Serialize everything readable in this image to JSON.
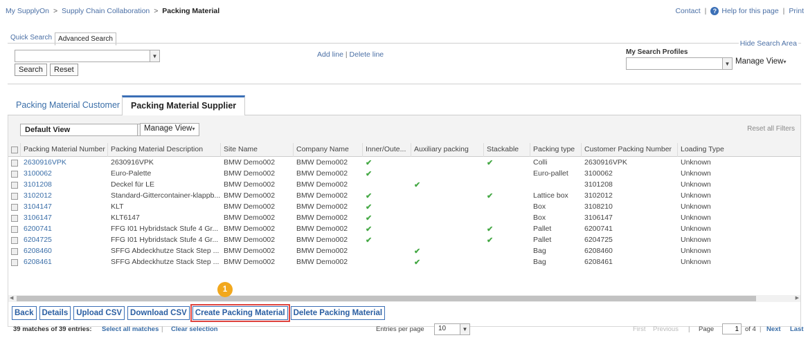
{
  "breadcrumb": {
    "home": "My SupplyOn",
    "parent": "Supply Chain Collaboration",
    "current": "Packing Material",
    "sep": ">"
  },
  "toplinks": {
    "contact": "Contact",
    "help": "Help for this page",
    "print": "Print",
    "sep": "|"
  },
  "search": {
    "tabs": [
      "Quick Search",
      "Advanced Search"
    ],
    "hide_label": "Hide Search Area",
    "search_button": "Search",
    "reset_button": "Reset",
    "add_line": "Add line",
    "delete_line": "Delete line",
    "sep": "|",
    "profiles_label": "My Search Profiles",
    "manage_view": "Manage View"
  },
  "tabs": [
    "Packing Material Customer",
    "Packing Material Supplier"
  ],
  "view": {
    "selected": "Default View",
    "manage_view": "Manage View",
    "reset_filters": "Reset all Filters"
  },
  "columns": [
    "Packing Material Number",
    "Packing Material Description",
    "Site Name",
    "Company Name",
    "Inner/Oute...",
    "Auxiliary packing",
    "Stackable",
    "Packing type",
    "Customer Packing Number",
    "Loading Type"
  ],
  "rows": [
    [
      "2630916VPK",
      "2630916VPK",
      "BMW Demo002",
      "BMW Demo002",
      "✔",
      "",
      "✔",
      "Colli",
      "2630916VPK",
      "Unknown"
    ],
    [
      "3100062",
      "Euro-Palette",
      "BMW Demo002",
      "BMW Demo002",
      "✔",
      "",
      "",
      "Euro-pallet",
      "3100062",
      "Unknown"
    ],
    [
      "3101208",
      "Deckel für LE",
      "BMW Demo002",
      "BMW Demo002",
      "",
      "✔",
      "",
      "",
      "3101208",
      "Unknown"
    ],
    [
      "3102012",
      "Standard-Gittercontainer-klappb...",
      "BMW Demo002",
      "BMW Demo002",
      "✔",
      "",
      "✔",
      "Lattice box",
      "3102012",
      "Unknown"
    ],
    [
      "3104147",
      "KLT",
      "BMW Demo002",
      "BMW Demo002",
      "✔",
      "",
      "",
      "Box",
      "3108210",
      "Unknown"
    ],
    [
      "3106147",
      "KLT6147",
      "BMW Demo002",
      "BMW Demo002",
      "✔",
      "",
      "",
      "Box",
      "3106147",
      "Unknown"
    ],
    [
      "6200741",
      "FFG I01 Hybridstack Stufe 4 Gr...",
      "BMW Demo002",
      "BMW Demo002",
      "✔",
      "",
      "✔",
      "Pallet",
      "6200741",
      "Unknown"
    ],
    [
      "6204725",
      "FFG I01 Hybridstack Stufe 4 Gr...",
      "BMW Demo002",
      "BMW Demo002",
      "✔",
      "",
      "✔",
      "Pallet",
      "6204725",
      "Unknown"
    ],
    [
      "6208460",
      "SFFG Abdeckhutze Stack Step ...",
      "BMW Demo002",
      "BMW Demo002",
      "",
      "✔",
      "",
      "Bag",
      "6208460",
      "Unknown"
    ],
    [
      "6208461",
      "SFFG Abdeckhutze Stack Step ...",
      "BMW Demo002",
      "BMW Demo002",
      "",
      "✔",
      "",
      "Bag",
      "6208461",
      "Unknown"
    ]
  ],
  "marker": "1",
  "actions": [
    "Back",
    "Details",
    "Upload CSV",
    "Download CSV",
    "Create Packing Material",
    "Delete Packing Material"
  ],
  "footer": {
    "matches": "39 matches of 39 entries:",
    "select_all": "Select all matches",
    "clear": "Clear selection",
    "sep": "|",
    "entries_label": "Entries per page",
    "entries_value": "10",
    "first": "First",
    "previous": "Previous",
    "page_label": "Page",
    "page_value": "1",
    "of": "of 4",
    "next": "Next",
    "last": "Last"
  },
  "colors": {
    "link": "#3a6ea8",
    "accent": "#3b6fb6",
    "check": "#44a844",
    "marker": "#f2a81d",
    "highlight": "#e0443e"
  }
}
